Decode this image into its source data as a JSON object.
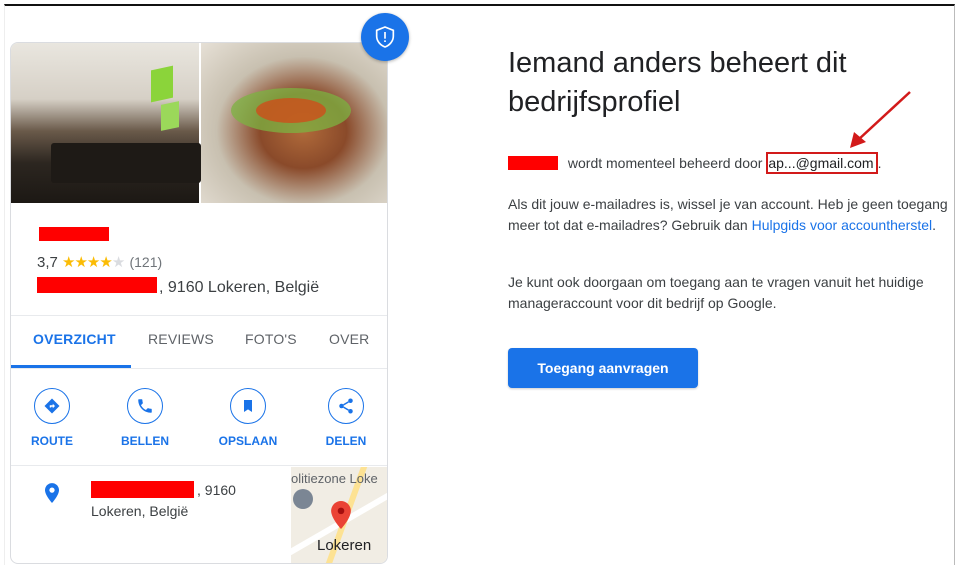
{
  "card": {
    "rating_value": "3,7",
    "stars_filled": "★★★★",
    "stars_empty": "★",
    "review_count": "(121)",
    "address_suffix": ", 9160 Lokeren, België",
    "tabs": [
      "OVERZICHT",
      "REVIEWS",
      "FOTO'S",
      "OVER"
    ],
    "actions": [
      {
        "label": "ROUTE",
        "icon": "directions-icon"
      },
      {
        "label": "BELLEN",
        "icon": "phone-icon"
      },
      {
        "label": "OPSLAAN",
        "icon": "bookmark-icon"
      },
      {
        "label": "DELEN",
        "icon": "share-icon"
      }
    ],
    "location_suffix": ", 9160",
    "location_line2": "Lokeren, België",
    "map_poi": "olitiezone Loke",
    "map_city": "Lokeren"
  },
  "panel": {
    "title": "Iemand anders beheert dit bedrijfsprofiel",
    "managed_by_text": "wordt momenteel beheerd door",
    "email": "ap...@gmail.com",
    "para1_text": "Als dit jouw e-mailadres is, wissel je van account. Heb je geen toegang meer tot dat e-mailadres? Gebruik dan",
    "para1_link": "Hulpgids voor accountherstel",
    "para2_text": "Je kunt ook doorgaan om toegang aan te vragen vanuit het huidige manageraccount voor dit bedrijf op Google.",
    "request_button": "Toegang aanvragen"
  },
  "colors": {
    "accent": "#1a73e8",
    "redaction": "#ff0000",
    "annotation": "#d21a1a",
    "star": "#fbbc04"
  }
}
